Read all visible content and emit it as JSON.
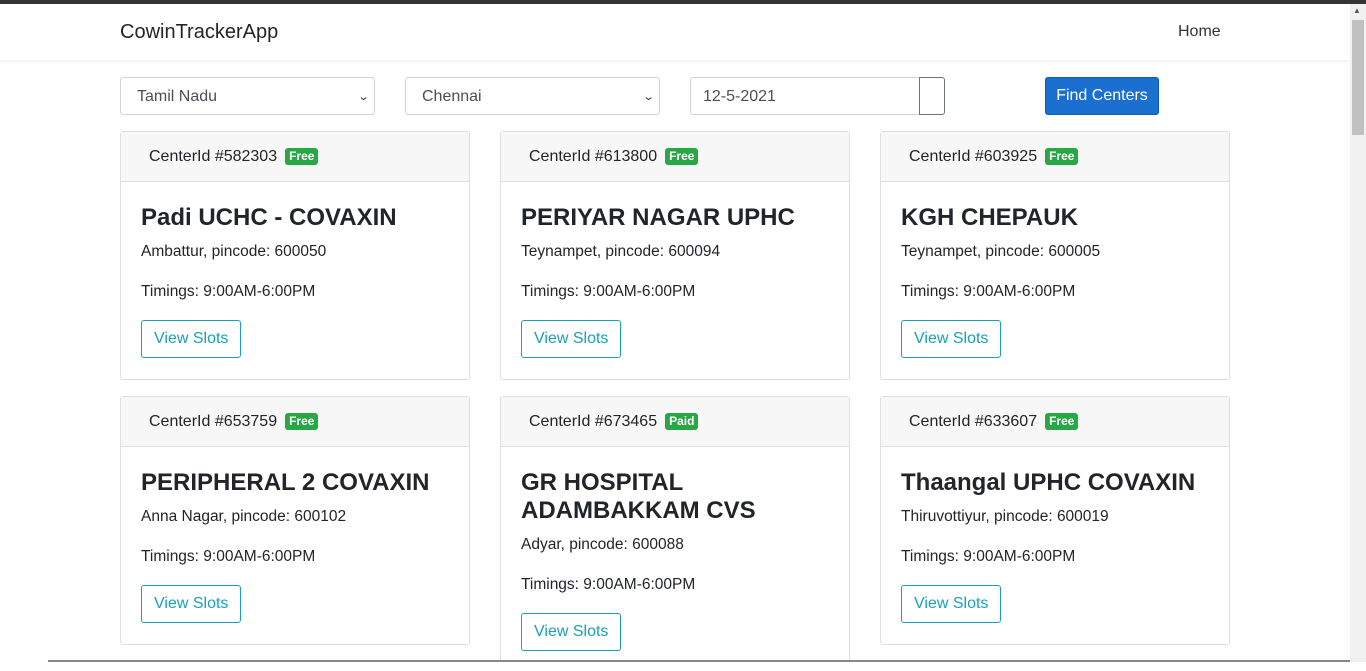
{
  "app": {
    "brand": "CowinTrackerApp",
    "nav_home": "Home"
  },
  "filters": {
    "state": "Tamil Nadu",
    "district": "Chennai",
    "date": "12-5-2021",
    "find_label": "Find Centers"
  },
  "cards": [
    {
      "header": "CenterId #582303",
      "badge": "Free",
      "title": "Padi UCHC - COVAXIN",
      "address": "Ambattur, pincode: 600050",
      "timings": "Timings: 9:00AM-6:00PM",
      "button": "View Slots"
    },
    {
      "header": "CenterId #613800",
      "badge": "Free",
      "title": "PERIYAR NAGAR UPHC",
      "address": "Teynampet, pincode: 600094",
      "timings": "Timings: 9:00AM-6:00PM",
      "button": "View Slots"
    },
    {
      "header": "CenterId #603925",
      "badge": "Free",
      "title": "KGH CHEPAUK",
      "address": "Teynampet, pincode: 600005",
      "timings": "Timings: 9:00AM-6:00PM",
      "button": "View Slots"
    },
    {
      "header": "CenterId #653759",
      "badge": "Free",
      "title": "PERIPHERAL 2 COVAXIN",
      "address": "Anna Nagar, pincode: 600102",
      "timings": "Timings: 9:00AM-6:00PM",
      "button": "View Slots"
    },
    {
      "header": "CenterId #673465",
      "badge": "Paid",
      "title": "GR HOSPITAL ADAMBAKKAM CVS",
      "address": "Adyar, pincode: 600088",
      "timings": "Timings: 9:00AM-6:00PM",
      "button": "View Slots"
    },
    {
      "header": "CenterId #633607",
      "badge": "Free",
      "title": "Thaangal UPHC COVAXIN",
      "address": "Thiruvottiyur, pincode: 600019",
      "timings": "Timings: 9:00AM-6:00PM",
      "button": "View Slots"
    }
  ],
  "colors": {
    "badge": "#28a745",
    "primary": "#1a6fd1",
    "outline": "#17a2b8"
  }
}
